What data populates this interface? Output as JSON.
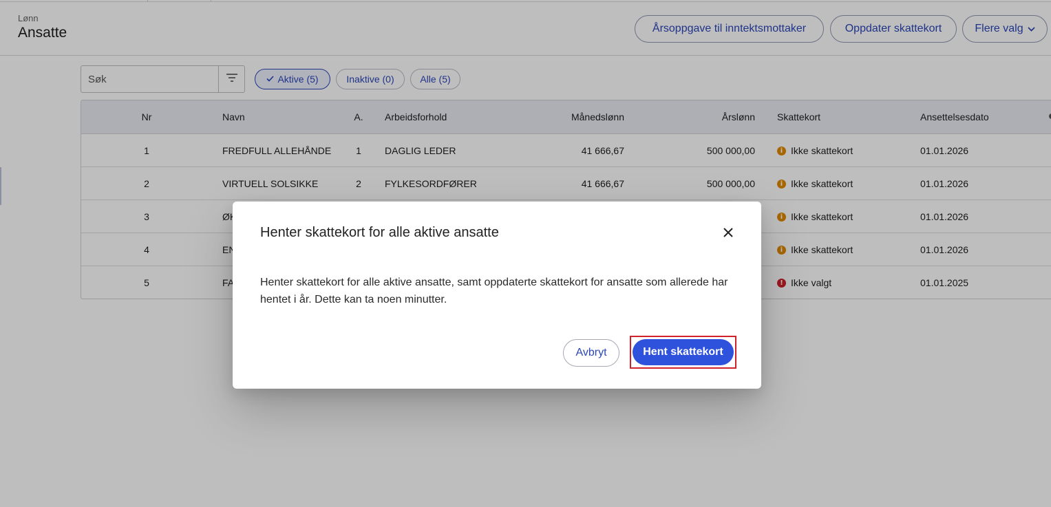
{
  "header": {
    "breadcrumb": "Lønn",
    "title": "Ansatte",
    "buttons": {
      "arsoppgave": "Årsoppgave til inntektsmottaker",
      "oppdater": "Oppdater skattekort",
      "flere_valg": "Flere valg"
    }
  },
  "search": {
    "placeholder": "Søk"
  },
  "filters": {
    "aktive": "Aktive (5)",
    "inaktive": "Inaktive (0)",
    "alle": "Alle (5)"
  },
  "table": {
    "columns": {
      "nr": "Nr",
      "navn": "Navn",
      "a": "A.",
      "arbeidsforhold": "Arbeidsforhold",
      "manedslonn": "Månedslønn",
      "arslonn": "Årslønn",
      "skattekort": "Skattekort",
      "ansettelsesdato": "Ansettelsesdato"
    },
    "rows": [
      {
        "nr": "1",
        "navn": "FREDFULL ALLEHÅNDE",
        "a": "1",
        "arbeidsforhold": "DAGLIG LEDER",
        "manedslonn": "41 666,67",
        "arslonn": "500 000,00",
        "skattekort": "Ikke skattekort",
        "status": "warning",
        "dato": "01.01.2026"
      },
      {
        "nr": "2",
        "navn": "VIRTUELL SOLSIKKE",
        "a": "2",
        "arbeidsforhold": "FYLKESORDFØRER",
        "manedslonn": "41 666,67",
        "arslonn": "500 000,00",
        "skattekort": "Ikke skattekort",
        "status": "warning",
        "dato": "01.01.2026"
      },
      {
        "nr": "3",
        "navn": "ØK",
        "a": "",
        "arbeidsforhold": "",
        "manedslonn": "",
        "arslonn": "",
        "skattekort": "Ikke skattekort",
        "status": "warning",
        "dato": "01.01.2026"
      },
      {
        "nr": "4",
        "navn": "EN",
        "a": "",
        "arbeidsforhold": "",
        "manedslonn": "",
        "arslonn": "",
        "skattekort": "Ikke skattekort",
        "status": "warning",
        "dato": "01.01.2026"
      },
      {
        "nr": "5",
        "navn": "FA",
        "a": "",
        "arbeidsforhold": "",
        "manedslonn": "",
        "arslonn": "",
        "skattekort": "Ikke valgt",
        "status": "error",
        "dato": "01.01.2025"
      }
    ]
  },
  "dialog": {
    "title": "Henter skattekort for alle aktive ansatte",
    "body": "Henter skattekort for alle aktive ansatte, samt oppdaterte skattekort for ansatte som allerede har hentet i år. Dette kan ta noen minutter.",
    "cancel_label": "Avbryt",
    "confirm_label": "Hent skattekort"
  },
  "colors": {
    "accent": "#2f52dc",
    "link": "#2a45b8",
    "warning": "#e08a00",
    "error": "#d0202a",
    "highlight": "#d0202a"
  },
  "icons": {
    "filter": "filter-icon",
    "close": "close-icon",
    "chevron": "chevron-down-icon",
    "check": "check-icon",
    "warning": "warning-icon",
    "error": "error-icon"
  }
}
